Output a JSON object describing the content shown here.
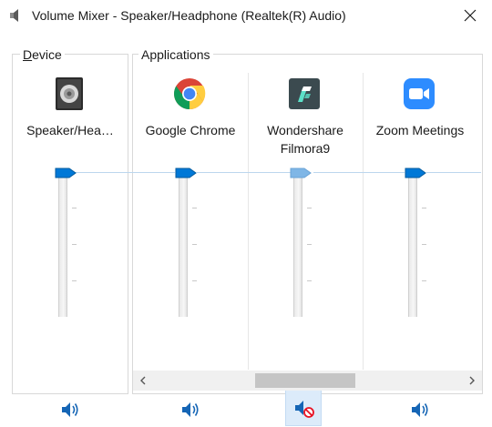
{
  "window": {
    "title": "Volume Mixer - Speaker/Headphone (Realtek(R) Audio)",
    "icon": "speaker-icon",
    "close_icon": "close-icon"
  },
  "device_group": {
    "label_accesskey": "D",
    "label_rest": "evice",
    "channel": {
      "name": "Speaker/Hea…",
      "icon": "speaker-device-icon",
      "volume_fraction": 1.0,
      "muted": false
    }
  },
  "applications_group": {
    "label": "Applications",
    "channels": [
      {
        "name": "Google Chrome",
        "icon": "chrome-icon",
        "volume_fraction": 1.0,
        "muted": false
      },
      {
        "name": "Wondershare\nFilmora9",
        "icon": "filmora-icon",
        "volume_fraction": 1.0,
        "muted": true,
        "disabled": true
      },
      {
        "name": "Zoom Meetings",
        "icon": "zoom-icon",
        "volume_fraction": 1.0,
        "muted": false
      }
    ]
  },
  "colors": {
    "accent": "#0063b1",
    "thumb": "#0078d7",
    "thumb_disabled": "#7fb6e6",
    "peak_line": "#bcd7ee",
    "mute_active_bg": "#dcebfa",
    "mute_badge": "#e81123"
  },
  "scrollbar": {
    "left_icon": "chevron-left-icon",
    "right_icon": "chevron-right-icon"
  }
}
